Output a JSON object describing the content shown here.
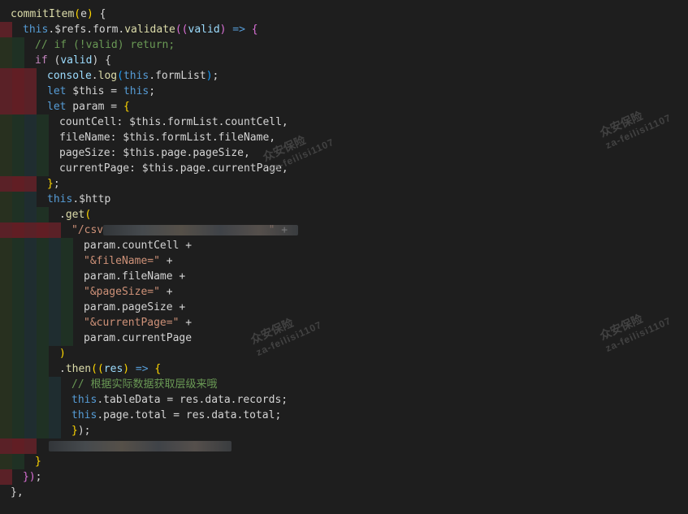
{
  "editor": {
    "lines": [
      {
        "segments": [
          {
            "cls": "tok-key",
            "text": "commitItem"
          },
          {
            "cls": "tok-paren1",
            "text": "("
          },
          {
            "cls": "tok-plain",
            "text": "e"
          },
          {
            "cls": "tok-paren1",
            "text": ")"
          },
          {
            "cls": "tok-plain",
            "text": " {"
          }
        ]
      },
      {
        "segments": [
          {
            "cls": "tok-this",
            "text": "this"
          },
          {
            "cls": "tok-plain",
            "text": ".$refs.form."
          },
          {
            "cls": "tok-fn",
            "text": "validate"
          },
          {
            "cls": "tok-paren2",
            "text": "(("
          },
          {
            "cls": "tok-var",
            "text": "valid"
          },
          {
            "cls": "tok-paren2",
            "text": ")"
          },
          {
            "cls": "tok-this",
            "text": " => "
          },
          {
            "cls": "tok-paren2",
            "text": "{"
          }
        ]
      },
      {
        "segments": [
          {
            "cls": "tok-cmt",
            "text": "// if (!valid) return;"
          }
        ]
      },
      {
        "segments": [
          {
            "cls": "tok-kw",
            "text": "if"
          },
          {
            "cls": "tok-plain",
            "text": " ("
          },
          {
            "cls": "tok-var",
            "text": "valid"
          },
          {
            "cls": "tok-plain",
            "text": ") {"
          }
        ]
      },
      {
        "segments": [
          {
            "cls": "tok-var",
            "text": "console"
          },
          {
            "cls": "tok-plain",
            "text": "."
          },
          {
            "cls": "tok-fn",
            "text": "log"
          },
          {
            "cls": "tok-paren3",
            "text": "("
          },
          {
            "cls": "tok-this",
            "text": "this"
          },
          {
            "cls": "tok-plain",
            "text": ".formList"
          },
          {
            "cls": "tok-paren3",
            "text": ")"
          },
          {
            "cls": "tok-plain",
            "text": ";"
          }
        ]
      },
      {
        "segments": [
          {
            "cls": "tok-this",
            "text": "let"
          },
          {
            "cls": "tok-plain",
            "text": " $this = "
          },
          {
            "cls": "tok-this",
            "text": "this"
          },
          {
            "cls": "tok-plain",
            "text": ";"
          }
        ]
      },
      {
        "segments": [
          {
            "cls": "tok-this",
            "text": "let"
          },
          {
            "cls": "tok-plain",
            "text": " param = "
          },
          {
            "cls": "tok-paren1",
            "text": "{"
          }
        ]
      },
      {
        "segments": [
          {
            "cls": "tok-plain",
            "text": "countCell: $this.formList.countCell,"
          }
        ]
      },
      {
        "segments": [
          {
            "cls": "tok-plain",
            "text": "fileName: $this.formList.fileName,"
          }
        ]
      },
      {
        "segments": [
          {
            "cls": "tok-plain",
            "text": "pageSize: $this.page.pageSize,"
          }
        ]
      },
      {
        "segments": [
          {
            "cls": "tok-plain",
            "text": "currentPage: $this.page.currentPage,"
          }
        ]
      },
      {
        "segments": [
          {
            "cls": "tok-paren1",
            "text": "}"
          },
          {
            "cls": "tok-plain",
            "text": ";"
          }
        ]
      },
      {
        "segments": [
          {
            "cls": "tok-this",
            "text": "this"
          },
          {
            "cls": "tok-plain",
            "text": ".$http"
          }
        ]
      },
      {
        "segments": [
          {
            "cls": "tok-plain",
            "text": "."
          },
          {
            "cls": "tok-fn",
            "text": "get"
          },
          {
            "cls": "tok-paren1",
            "text": "("
          }
        ]
      },
      {
        "segments": [
          {
            "cls": "tok-str",
            "text": "\"/csv"
          },
          {
            "cls": "tok-plain",
            "text": "                          "
          },
          {
            "cls": "tok-str",
            "text": "\""
          },
          {
            "cls": "tok-plain",
            "text": " +"
          }
        ]
      },
      {
        "segments": [
          {
            "cls": "tok-plain",
            "text": "param.countCell +"
          }
        ]
      },
      {
        "segments": [
          {
            "cls": "tok-str",
            "text": "\"&fileName=\""
          },
          {
            "cls": "tok-plain",
            "text": " +"
          }
        ]
      },
      {
        "segments": [
          {
            "cls": "tok-plain",
            "text": "param.fileName +"
          }
        ]
      },
      {
        "segments": [
          {
            "cls": "tok-str",
            "text": "\"&pageSize=\""
          },
          {
            "cls": "tok-plain",
            "text": " +"
          }
        ]
      },
      {
        "segments": [
          {
            "cls": "tok-plain",
            "text": "param.pageSize +"
          }
        ]
      },
      {
        "segments": [
          {
            "cls": "tok-str",
            "text": "\"&currentPage=\""
          },
          {
            "cls": "tok-plain",
            "text": " +"
          }
        ]
      },
      {
        "segments": [
          {
            "cls": "tok-plain",
            "text": "param.currentPage"
          }
        ]
      },
      {
        "segments": [
          {
            "cls": "tok-paren1",
            "text": ")"
          }
        ]
      },
      {
        "segments": [
          {
            "cls": "tok-plain",
            "text": "."
          },
          {
            "cls": "tok-fn",
            "text": "then"
          },
          {
            "cls": "tok-paren1",
            "text": "(("
          },
          {
            "cls": "tok-var",
            "text": "res"
          },
          {
            "cls": "tok-paren1",
            "text": ")"
          },
          {
            "cls": "tok-this",
            "text": " => "
          },
          {
            "cls": "tok-paren1",
            "text": "{"
          }
        ]
      },
      {
        "segments": [
          {
            "cls": "tok-cmt",
            "text": "// 根据实际数据获取层级来哦"
          }
        ]
      },
      {
        "segments": [
          {
            "cls": "tok-this",
            "text": "this"
          },
          {
            "cls": "tok-plain",
            "text": ".tableData = res.data.records;"
          }
        ]
      },
      {
        "segments": [
          {
            "cls": "tok-this",
            "text": "this"
          },
          {
            "cls": "tok-plain",
            "text": ".page.total = res.data.total;"
          }
        ]
      },
      {
        "segments": [
          {
            "cls": "tok-paren1",
            "text": "}"
          },
          {
            "cls": "tok-plain",
            "text": ");"
          }
        ]
      },
      {
        "segments": []
      },
      {
        "segments": [
          {
            "cls": "tok-paren1",
            "text": "}"
          }
        ]
      },
      {
        "segments": [
          {
            "cls": "tok-paren2",
            "text": "})"
          },
          {
            "cls": "tok-plain",
            "text": ";"
          }
        ]
      },
      {
        "segments": [
          {
            "cls": "tok-plain",
            "text": "},"
          }
        ]
      }
    ]
  },
  "watermark": {
    "name": "众安保险",
    "user": "za-feilisi1107"
  }
}
